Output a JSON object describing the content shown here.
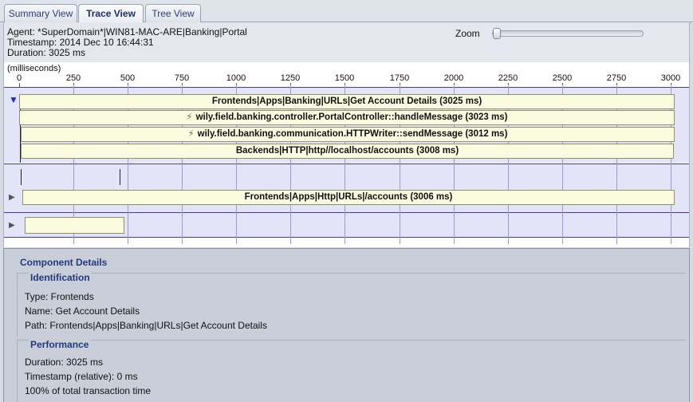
{
  "tabs": [
    {
      "label": "Summary View",
      "active": false
    },
    {
      "label": "Trace View",
      "active": true
    },
    {
      "label": "Tree View",
      "active": false
    }
  ],
  "header": {
    "agent": "Agent: *SuperDomain*|WIN81-MAC-ARE|Banking|Portal",
    "timestamp": "Timestamp: 2014 Dec 10 16:44:31",
    "duration": "Duration: 3025 ms",
    "zoom_label": "Zoom",
    "zoom_level": 0
  },
  "timeline": {
    "unit_label": "(milliseconds)",
    "axis_max": 3025,
    "ticks": [
      "0",
      "250",
      "500",
      "750",
      "1000",
      "1250",
      "1500",
      "1750",
      "2000",
      "2250",
      "2500",
      "2750",
      "3000"
    ],
    "bars": [
      {
        "label": "Frontends|Apps|Banking|URLs|Get Account Details (3025 ms)",
        "start": 0,
        "duration": 3025,
        "bolt": false
      },
      {
        "label": "wily.field.banking.controller.PortalController::handleMessage (3023 ms)",
        "start": 1,
        "duration": 3023,
        "bolt": true
      },
      {
        "label": "wily.field.banking.communication.HTTPWriter::sendMessage (3012 ms)",
        "start": 7,
        "duration": 3012,
        "bolt": true
      },
      {
        "label": "Backends|HTTP|http//localhost/accounts (3008 ms)",
        "start": 9,
        "duration": 3008,
        "bolt": false
      },
      {
        "label": "Frontends|Apps|Http|URLs|/accounts (3006 ms)",
        "start": 15,
        "duration": 3006,
        "bolt": false
      },
      {
        "label": "",
        "start": 25,
        "duration": 460,
        "bolt": false
      }
    ],
    "icons": {
      "expanded": "triangle-down-icon",
      "collapsed": "triangle-right-icon",
      "bolt": "lightning-icon"
    },
    "colors": {
      "bar_fill": "#fbfbe0",
      "grid": "#9b98df",
      "section_bg": "#e4e4f8"
    }
  },
  "details": {
    "title": "Component Details",
    "identification": {
      "title": "Identification",
      "type": "Type: Frontends",
      "name": "Name: Get Account Details",
      "path": "Path: Frontends|Apps|Banking|URLs|Get Account Details"
    },
    "performance": {
      "title": "Performance",
      "duration": "Duration: 3025 ms",
      "timestamp_relative": "Timestamp (relative): 0 ms",
      "percent_total": "100% of total transaction time"
    }
  }
}
